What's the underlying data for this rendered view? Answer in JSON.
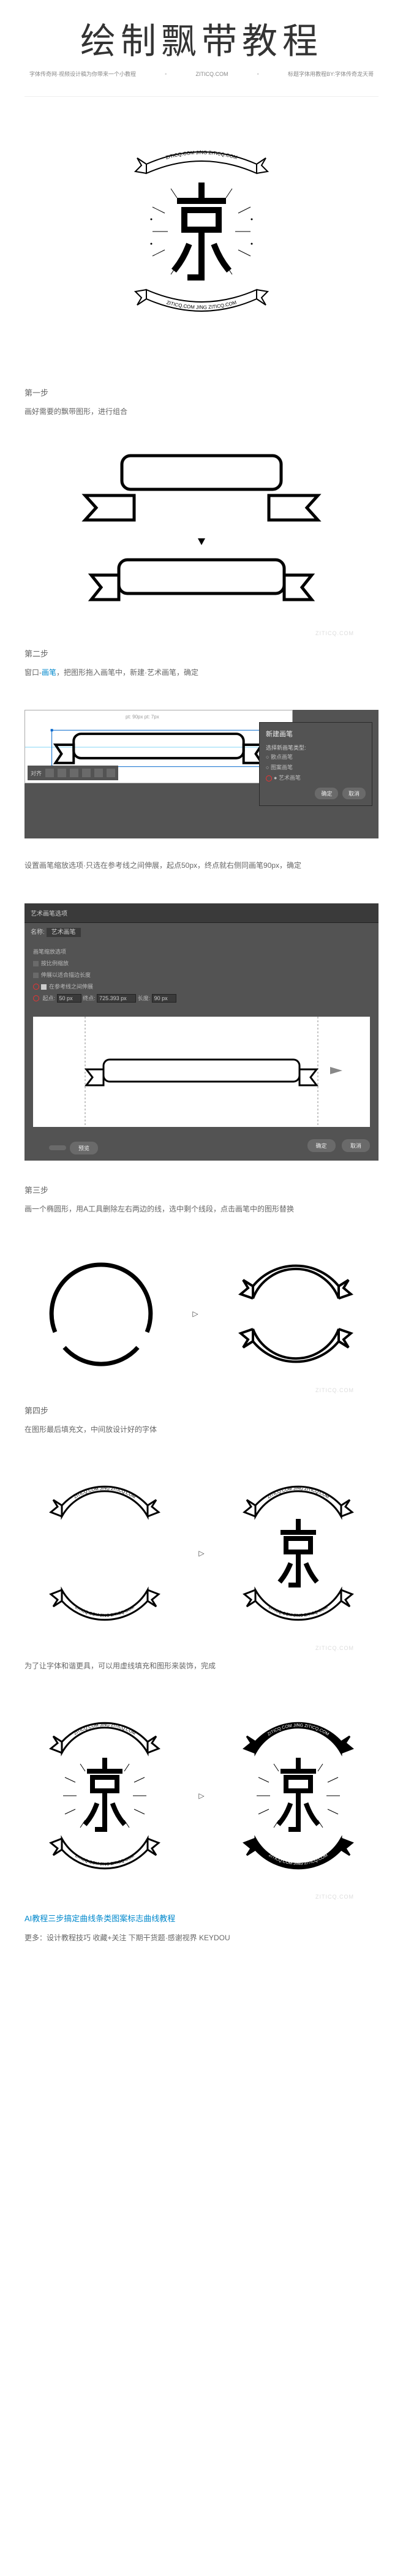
{
  "header": {
    "title": "绘制飘带教程",
    "sub_left": "字体传奇网·视频设计稿为你带来一个小教程",
    "sub_center": "ZITICQ.COM",
    "sub_right": "标题字体用教程BY:字体传奇龙天哥"
  },
  "logo": {
    "top_text": "ZITICQ.COM JING ZITICQ.COM",
    "bottom_text": "ZITICQ.COM JING ZITICQ.COM",
    "center": "京"
  },
  "step1": {
    "label": "第一步",
    "desc": "画好需要的飘带图形，进行组合"
  },
  "step2": {
    "label": "第二步",
    "desc_prefix": "窗口-",
    "desc_link": "画笔",
    "desc_suffix": "，把图形拖入画笔中，新建·艺术画笔，确定",
    "caption": "设置画笔缩放选项·只选在参考线之间伸展，起点50px，终点就右侧同画笔90px，确定",
    "ruler": "pt: 90px\npt: 7px",
    "panel": {
      "title": "新建画笔",
      "label1": "选择新画笔类型:",
      "opt1": "散点画笔",
      "opt2": "图案画笔",
      "opt3": "艺术画笔",
      "ok": "确定",
      "cancel": "取消"
    },
    "align_title": "对齐",
    "shot2": {
      "top_name": "艺术画笔选项",
      "tab1": "名称",
      "tab2": "艺术画笔",
      "opt_a": "画笔缩放选项",
      "opt_b": "按比例缩放",
      "opt_c": "伸展以适合描边长度",
      "opt_d": "在参考线之间伸展",
      "start_label": "起点:",
      "start_val": "50 px",
      "end_label": "终点:",
      "end_val": "725.393 px",
      "len_label": "长度:",
      "len_val": "90 px",
      "preview": "预览",
      "ok": "确定",
      "cancel": "取消"
    }
  },
  "step3": {
    "label": "第三步",
    "desc": "画一个椭圆形，用A工具删除左右两边的线，选中剩个线段，点击画笔中的图形替换"
  },
  "step4": {
    "label": "第四步",
    "desc": "在图形最后填充文，中间放设计好的字体",
    "desc2": "为了让字体和谐更具，可以用虚线填充和图形来装饰，完成"
  },
  "footer": {
    "title": "AI教程三步搞定曲线条类图案标志曲线教程",
    "desc": "更多：设计教程技巧 收藏+关注 下期干货题·感谢视界 KEYDOU"
  },
  "wm": "ZITICQ.COM",
  "arrow": "▷"
}
